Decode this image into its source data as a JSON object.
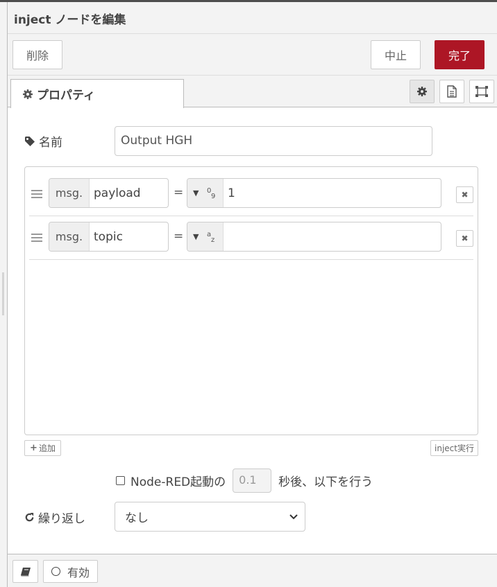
{
  "header": {
    "title": "inject ノードを編集"
  },
  "toolbar": {
    "delete_label": "削除",
    "cancel_label": "中止",
    "done_label": "完了"
  },
  "tabs": {
    "properties_label": "プロパティ"
  },
  "form": {
    "name_label": "名前",
    "name_value": "Output HGH",
    "props": [
      {
        "prefix": "msg.",
        "property": "payload",
        "type_glyph": "0/9",
        "value": "1"
      },
      {
        "prefix": "msg.",
        "property": "topic",
        "type_glyph": "a/z",
        "value": ""
      }
    ],
    "add_label": "追加",
    "inject_label": "inject実行",
    "once_label": "Node-RED起動の",
    "delay_placeholder": "0.1",
    "once_suffix": "秒後、以下を行う",
    "repeat_label": "繰り返し",
    "repeat_value": "なし"
  },
  "footer": {
    "enabled_label": "有効"
  },
  "icons": [
    "gear-icon",
    "tag-icon",
    "file-text-icon",
    "window-icon",
    "close-icon",
    "plus-icon",
    "refresh-icon",
    "book-icon",
    "chevron-down-icon",
    "drag-handle-icon",
    "caret-down-icon"
  ],
  "colors": {
    "primary": "#ad1625",
    "border": "#cccccc",
    "panel": "#f3f3f3"
  }
}
